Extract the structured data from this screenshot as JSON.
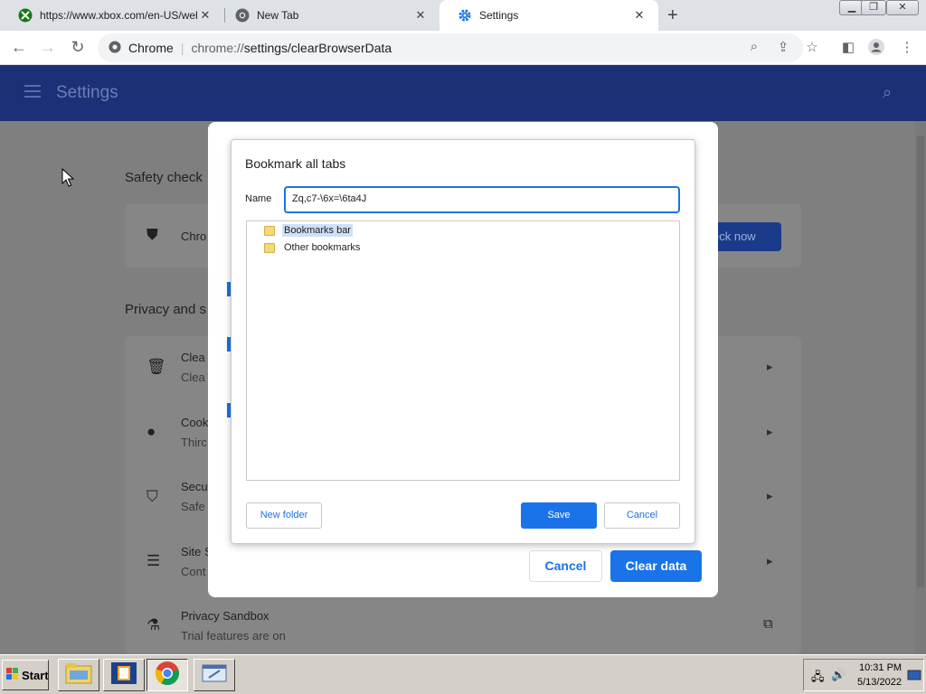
{
  "tabs": [
    {
      "title": "https://www.xbox.com/en-US/webg",
      "icon": "xbox-icon"
    },
    {
      "title": "New Tab",
      "icon": "chrome-icon"
    },
    {
      "title": "Settings",
      "icon": "gear-icon"
    }
  ],
  "omnibox": {
    "site_label": "Chrome",
    "separator": "|",
    "url_prefix": "chrome://",
    "url_path": "settings/clearBrowserData"
  },
  "settings_header": {
    "title": "Settings"
  },
  "background": {
    "safety_check_title": "Safety check",
    "safety_row_text": "Chro",
    "check_now_label": "eck now",
    "privacy_title": "Privacy and s",
    "rows": [
      {
        "title": "Clea",
        "subtitle": "Clea",
        "icon": "trash-icon"
      },
      {
        "title": "Cook",
        "subtitle": "Thirc",
        "icon": "cookie-icon"
      },
      {
        "title": "Secu",
        "subtitle": "Safe",
        "icon": "shield-icon"
      },
      {
        "title": "Site S",
        "subtitle": "Cont",
        "icon": "sliders-icon"
      },
      {
        "title": "Privacy Sandbox",
        "subtitle": "Trial features are on",
        "icon": "flask-icon"
      }
    ],
    "dialog_cancel": "Cancel",
    "dialog_clear": "Clear data"
  },
  "bookmark_dialog": {
    "title": "Bookmark all tabs",
    "name_label": "Name",
    "name_value": "Zq,c7-\\6x=\\6ta4J",
    "folders": [
      {
        "label": "Bookmarks bar",
        "selected": true
      },
      {
        "label": "Other bookmarks",
        "selected": false
      }
    ],
    "new_folder": "New folder",
    "save": "Save",
    "cancel": "Cancel"
  },
  "taskbar": {
    "start": "Start",
    "time": "10:31 PM",
    "date": "5/13/2022"
  },
  "colors": {
    "accent": "#1a73e8",
    "settings_bar": "#1b3076",
    "taskbar": "#d4d0c8"
  }
}
